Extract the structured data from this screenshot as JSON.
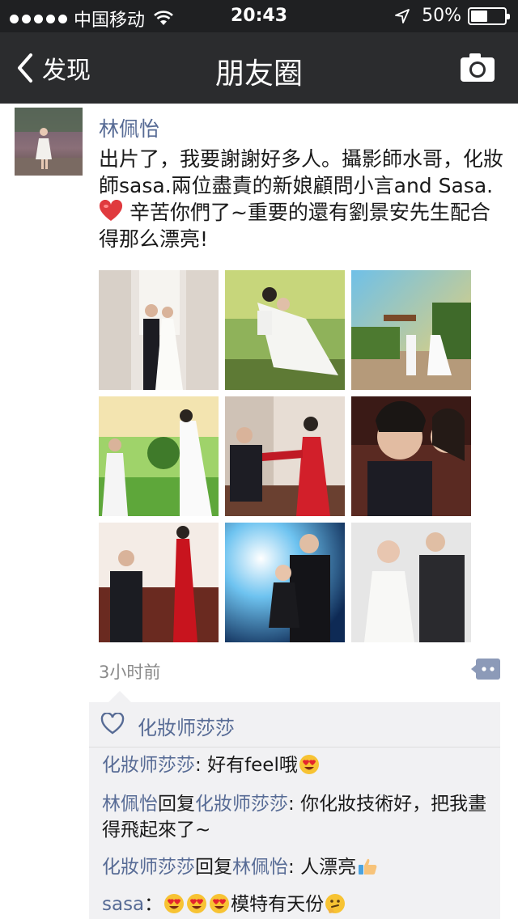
{
  "status_bar": {
    "carrier": "中国移动",
    "time": "20:43",
    "battery": "50%",
    "battery_level": 0.5,
    "icons": [
      "signal-dots-icon",
      "wifi-icon",
      "location-arrow-icon",
      "battery-icon"
    ]
  },
  "nav": {
    "back_label": "发现",
    "title": "朋友圈",
    "right_icon": "camera-icon"
  },
  "post": {
    "author": "林佩怡",
    "text_1": "出片了，我要謝謝好多人。攝影師水哥，化妝師sasa.兩位盡責的新娘顧問小言and Sasa. ",
    "text_2": "辛苦你們了~重要的還有劉景安先生配合得那么漂亮!",
    "text_emoji": "heart-emoji",
    "time_ago": "3小时前",
    "photo_count": 9
  },
  "comments_area": {
    "likes": "化妝师莎莎",
    "comments": [
      {
        "author": "化妝师莎莎",
        "reply_word": "",
        "reply_to": "",
        "sep": ": ",
        "text": "好有feel哦",
        "emoji": "heart-eyes-emoji"
      },
      {
        "author": "林佩怡",
        "reply_word": "回复",
        "reply_to": "化妝师莎莎",
        "sep": ": ",
        "text": "你化妝技術好，把我畫得飛起來了~"
      },
      {
        "author": "化妝师莎莎",
        "reply_word": "回复",
        "reply_to": "林佩怡",
        "sep": ": ",
        "text": "人漂亮",
        "emoji": "thumbs-up-emoji"
      },
      {
        "author": "sasa",
        "reply_word": "",
        "reply_to": "",
        "sep": "：",
        "text": "模特有天份",
        "emoji": "thinking-emoji"
      }
    ]
  },
  "colors": {
    "status_bg": "#1f2022",
    "nav_bg": "#2b2c2e",
    "link": "#576b95",
    "comment_bg": "#f1f1f3"
  }
}
